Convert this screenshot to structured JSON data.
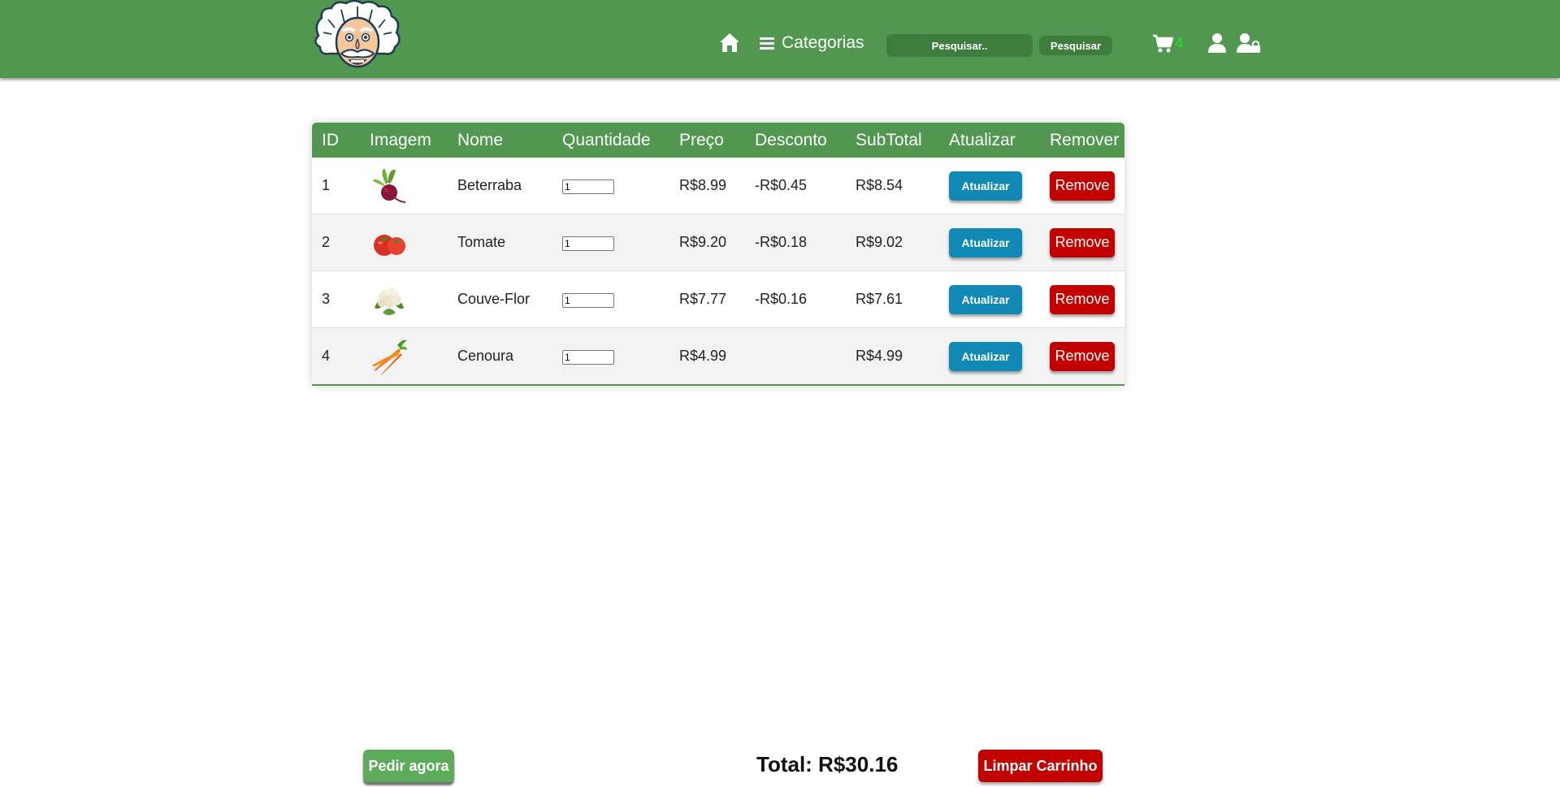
{
  "header": {
    "logo_icon": "einstein-logo-icon",
    "home_icon": "home-icon",
    "categories_icon": "menu-icon",
    "categories_label": "Categorias",
    "search_placeholder": "Pesquisar..",
    "search_button_label": "Pesquisar",
    "cart_icon": "cart-icon",
    "cart_count": "4",
    "user_icon": "user-icon",
    "user_lock_icon": "user-lock-icon",
    "accent_color": "#529750"
  },
  "table": {
    "columns": [
      "ID",
      "Imagem",
      "Nome",
      "Quantidade",
      "Preço",
      "Desconto",
      "SubTotal",
      "Atualizar",
      "Remover"
    ],
    "rows": [
      {
        "id": "1",
        "image": "beet-image",
        "name": "Beterraba",
        "quantity": "1",
        "price": "R$8.99",
        "discount": "-R$0.45",
        "subtotal": "R$8.54",
        "update_label": "Atualizar",
        "remove_label": "Remove"
      },
      {
        "id": "2",
        "image": "tomato-image",
        "name": "Tomate",
        "quantity": "1",
        "price": "R$9.20",
        "discount": "-R$0.18",
        "subtotal": "R$9.02",
        "update_label": "Atualizar",
        "remove_label": "Remove"
      },
      {
        "id": "3",
        "image": "cauliflower-image",
        "name": "Couve-Flor",
        "quantity": "1",
        "price": "R$7.77",
        "discount": "-R$0.16",
        "subtotal": "R$7.61",
        "update_label": "Atualizar",
        "remove_label": "Remove"
      },
      {
        "id": "4",
        "image": "carrot-image",
        "name": "Cenoura",
        "quantity": "1",
        "price": "R$4.99",
        "discount": "",
        "subtotal": "R$4.99",
        "update_label": "Atualizar",
        "remove_label": "Remove"
      }
    ]
  },
  "footer": {
    "order_button_label": "Pedir agora",
    "total_label": "Total: R$30.16",
    "clear_button_label": "Limpar Carrinho"
  },
  "colors": {
    "update_button": "#1289b4",
    "remove_button": "#c30000",
    "order_button": "#5cab5a"
  }
}
